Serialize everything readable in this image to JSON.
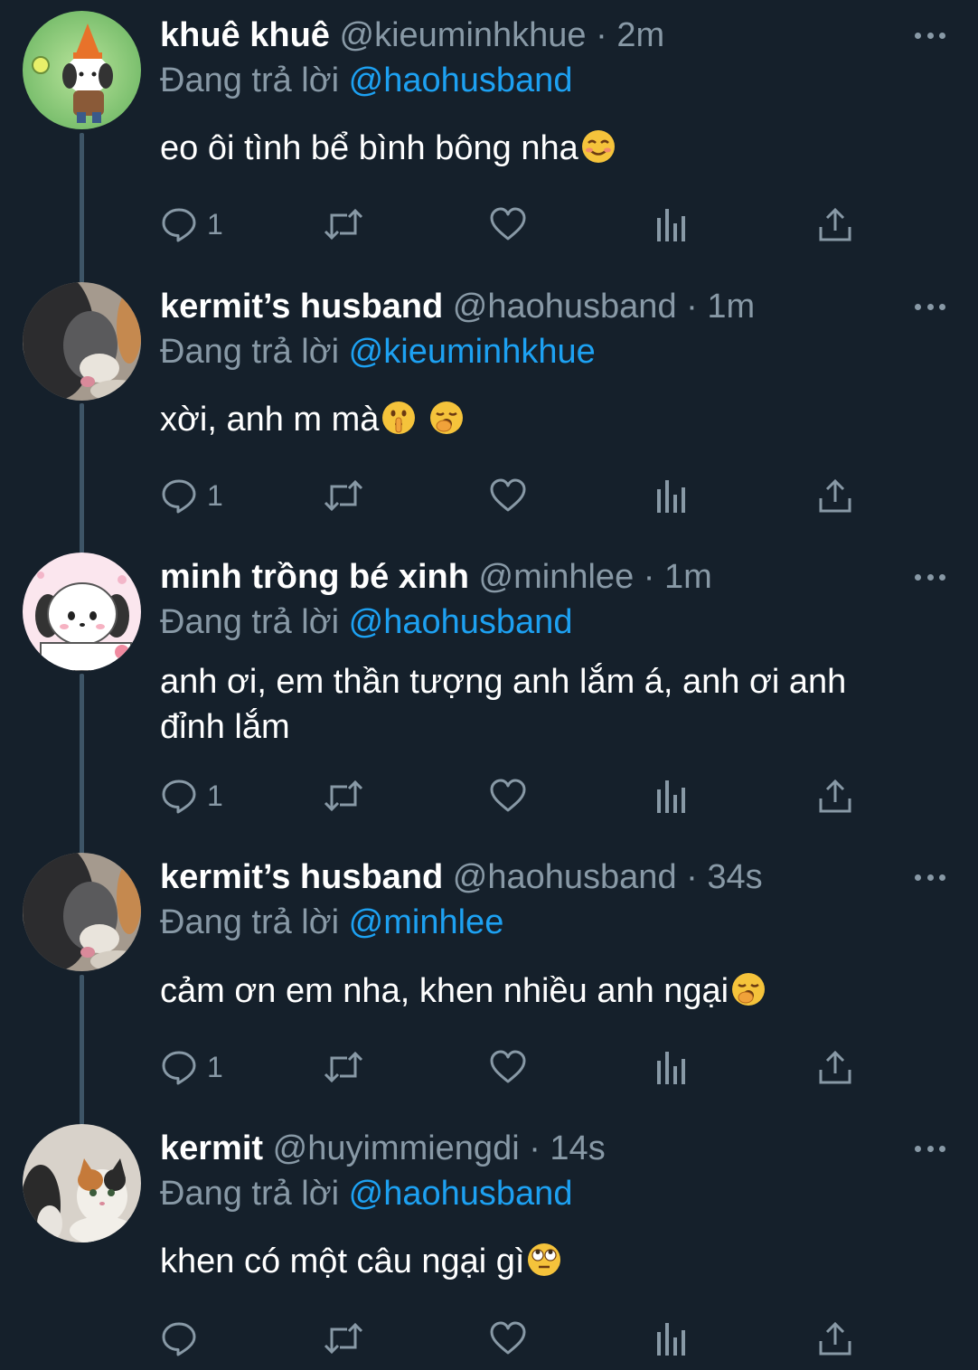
{
  "colors": {
    "background": "#15202b",
    "text": "#ffffff",
    "secondary": "#8899a6",
    "accent": "#1da1f2",
    "thread_line": "#3d5466"
  },
  "reply_prefix": "Đang trả lời",
  "tweets": [
    {
      "name": "khuê khuê",
      "handle": "@kieuminhkhue",
      "separator": "·",
      "time": "2m",
      "reply_to": "@haohusband",
      "text_lines": [
        "eo ôi tình bể bình bông nha"
      ],
      "emoji": [
        "smiling-face-icon"
      ],
      "reply_count": "1"
    },
    {
      "name": "kermit’s husband",
      "handle": "@haohusband",
      "separator": "·",
      "time": "1m",
      "reply_to": "@kieuminhkhue",
      "text_lines": [
        "xời, anh m mà"
      ],
      "emoji": [
        "shushing-face-icon",
        "yawning-face-icon"
      ],
      "reply_count": "1"
    },
    {
      "name": "minh trồng bé xinh",
      "handle": "@minhlee",
      "separator": "·",
      "time": "1m",
      "reply_to": "@haohusband",
      "text_lines": [
        "anh ơi, em thần tượng anh lắm á, anh ơi anh",
        "đỉnh lắm"
      ],
      "emoji": [],
      "reply_count": "1"
    },
    {
      "name": "kermit’s husband",
      "handle": "@haohusband",
      "separator": "·",
      "time": "34s",
      "reply_to": "@minhlee",
      "text_lines": [
        "cảm ơn em nha, khen nhiều anh ngại"
      ],
      "emoji": [
        "yawning-face-icon"
      ],
      "reply_count": "1"
    },
    {
      "name": "kermit",
      "handle": "@huyimmiengdi",
      "separator": "·",
      "time": "14s",
      "reply_to": "@haohusband",
      "text_lines": [
        "khen có một câu ngại gì"
      ],
      "emoji": [
        "eye-roll-face-icon"
      ],
      "reply_count": ""
    }
  ],
  "action_icons": [
    "reply-icon",
    "retweet-icon",
    "like-icon",
    "analytics-icon",
    "share-icon"
  ]
}
